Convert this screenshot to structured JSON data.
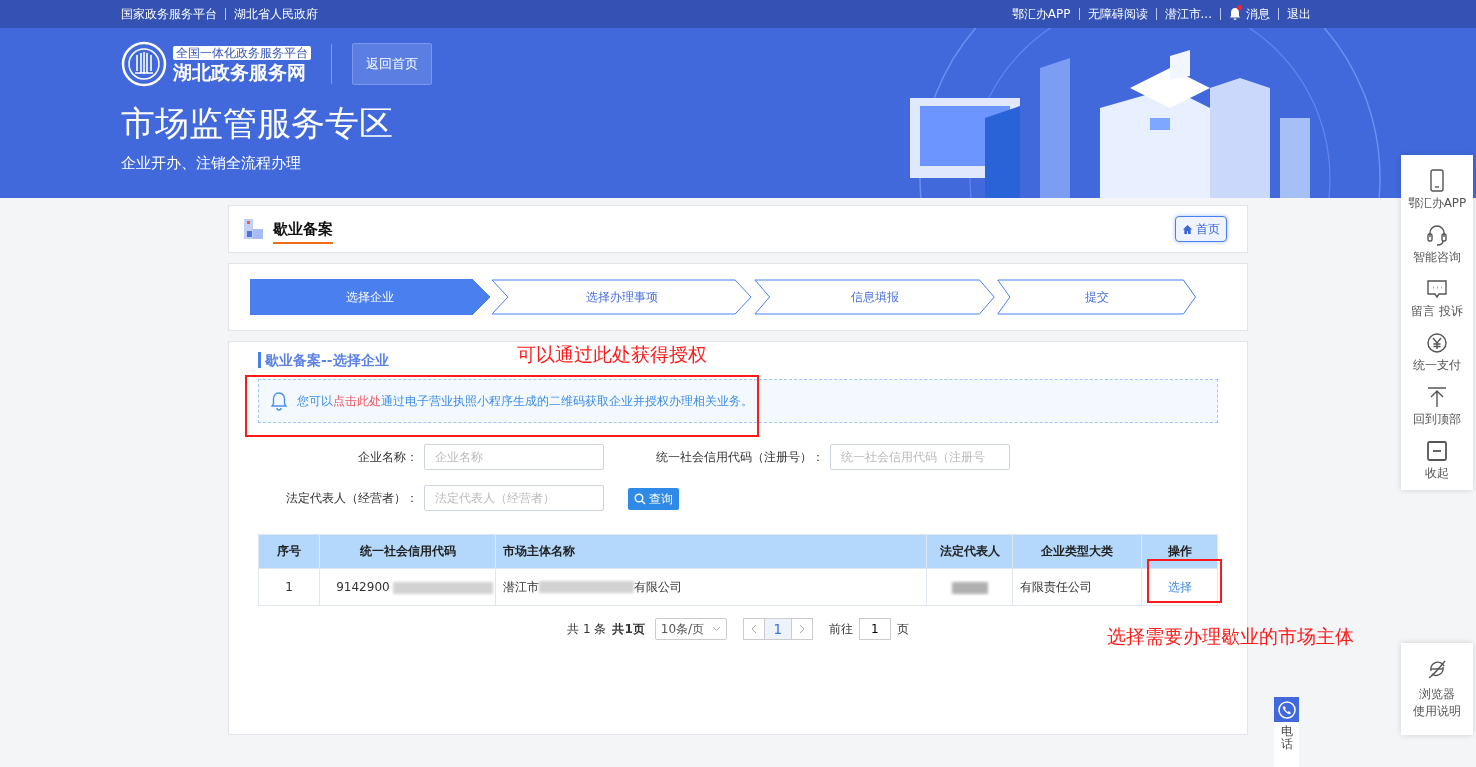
{
  "top_bar": {
    "left_links": [
      "国家政务服务平台",
      "湖北省人民政府"
    ],
    "right_links": [
      {
        "kind": "text",
        "label": "鄂汇办APP"
      },
      {
        "kind": "text",
        "label": "无障碍阅读"
      },
      {
        "kind": "text",
        "label": "潜江市..."
      },
      {
        "kind": "bell",
        "label": "消息",
        "unread": true
      },
      {
        "kind": "text",
        "label": "退出"
      }
    ]
  },
  "header": {
    "logo_tag": "全国一体化政务服务平台",
    "logo_name": "湖北政务服务网",
    "home_button": "返回首页",
    "title": "市场监管服务专区",
    "subtitle": "企业开办、注销全流程办理"
  },
  "page_bar": {
    "title": "歇业备案",
    "home_button": "首页"
  },
  "steps": [
    {
      "label": "选择企业",
      "selected": true
    },
    {
      "label": "选择办理事项",
      "selected": false
    },
    {
      "label": "信息填报",
      "selected": false
    },
    {
      "label": "提交",
      "selected": false
    }
  ],
  "section": {
    "title": "歇业备案--选择企业",
    "notice": {
      "before": "您可以",
      "link": "点击此处",
      "after": "通过电子营业执照小程序生成的二维码获取企业并授权办理相关业务。"
    }
  },
  "search_form": {
    "fields": [
      {
        "label": "企业名称：",
        "placeholder": "企业名称"
      },
      {
        "label": "统一社会信用代码（注册号）：",
        "placeholder": "统一社会信用代码（注册号"
      },
      {
        "label": "法定代表人（经营者）：",
        "placeholder": "法定代表人（经营者）"
      }
    ],
    "search_button": "查询"
  },
  "table": {
    "columns": [
      "序号",
      "统一社会信用代码",
      "市场主体名称",
      "法定代表人",
      "企业类型大类",
      "操作"
    ],
    "rows": [
      {
        "index": "1",
        "credit_code": "9142900",
        "name_start": "潜江市",
        "name_end": "有限公司",
        "company_type": "有限责任公司",
        "action": "选择"
      }
    ]
  },
  "pagination": {
    "total": "共 1 条",
    "pages": "共1页",
    "page_size": "10条/页",
    "current_page": "1",
    "goto_label": "前往",
    "goto_value": "1",
    "goto_suffix": "页"
  },
  "annotations": [
    {
      "text": "可以通过此处获得授权"
    },
    {
      "text": "选择需要办理歇业的市场主体"
    }
  ],
  "side_tools": [
    {
      "kind": "phone",
      "label": "鄂汇办APP"
    },
    {
      "kind": "headset",
      "label": "智能咨询"
    },
    {
      "kind": "message",
      "label": "留言 投诉"
    },
    {
      "kind": "yuan",
      "label": "统一支付"
    },
    {
      "kind": "top",
      "label": "回到顶部"
    },
    {
      "kind": "collapse",
      "label": "收起"
    }
  ],
  "browser_help": {
    "lines": [
      "浏览器",
      "使用说明"
    ]
  },
  "phone_widget": {
    "label": "电话"
  }
}
